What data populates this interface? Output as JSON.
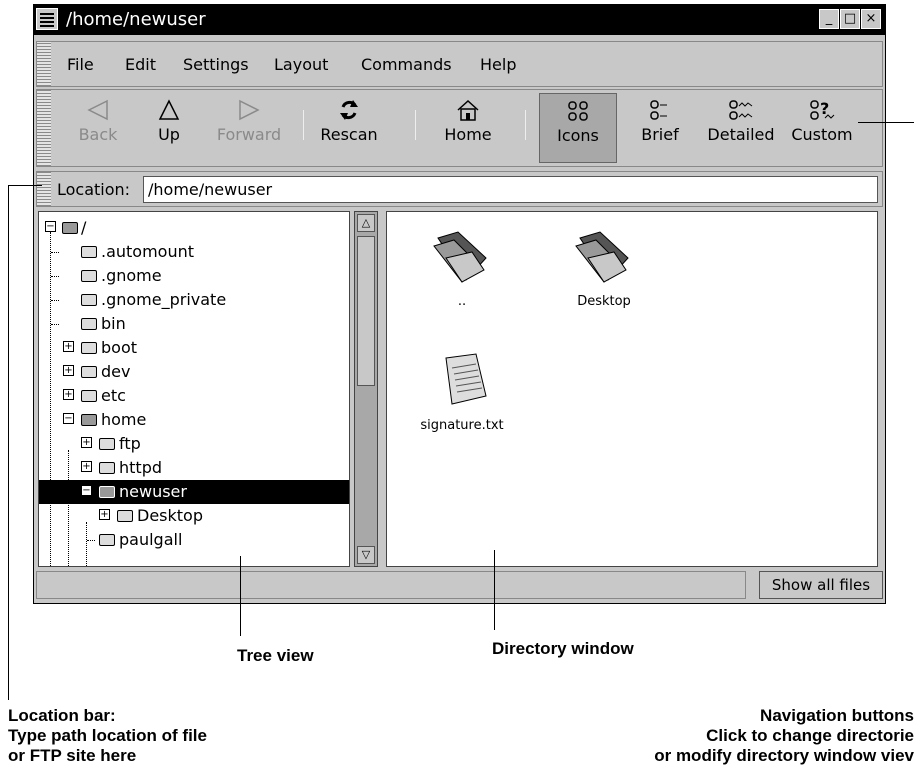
{
  "window": {
    "title": "/home/newuser",
    "controls": {
      "minimize": "_",
      "maximize": "□",
      "close": "×"
    }
  },
  "menubar": {
    "items": [
      {
        "label": "File"
      },
      {
        "label": "Edit"
      },
      {
        "label": "Settings"
      },
      {
        "label": "Layout"
      },
      {
        "label": "Commands"
      },
      {
        "label": "Help"
      }
    ]
  },
  "toolbar": {
    "back": {
      "label": "Back",
      "icon": "left-triangle-icon",
      "enabled": false
    },
    "up": {
      "label": "Up",
      "icon": "up-triangle-icon",
      "enabled": true
    },
    "forward": {
      "label": "Forward",
      "icon": "right-triangle-icon",
      "enabled": false
    },
    "rescan": {
      "label": "Rescan",
      "icon": "refresh-icon"
    },
    "home": {
      "label": "Home",
      "icon": "house-icon"
    },
    "icons": {
      "label": "Icons",
      "icon": "icons-view-icon",
      "pressed": true
    },
    "brief": {
      "label": "Brief",
      "icon": "brief-view-icon"
    },
    "detailed": {
      "label": "Detailed",
      "icon": "detailed-view-icon"
    },
    "custom": {
      "label": "Custom",
      "icon": "custom-view-icon"
    }
  },
  "location": {
    "label": "Location:",
    "value": "/home/newuser"
  },
  "tree": {
    "root": "/",
    "items": [
      {
        "label": ".automount"
      },
      {
        "label": ".gnome"
      },
      {
        "label": ".gnome_private"
      },
      {
        "label": "bin"
      },
      {
        "label": "boot",
        "expander": "+"
      },
      {
        "label": "dev",
        "expander": "+"
      },
      {
        "label": "etc",
        "expander": "+"
      },
      {
        "label": "home",
        "expander": "−"
      },
      {
        "label": "ftp",
        "expander": "+"
      },
      {
        "label": "httpd",
        "expander": "+"
      },
      {
        "label": "newuser",
        "expander": "−",
        "selected": true
      },
      {
        "label": "Desktop",
        "expander": "+"
      },
      {
        "label": "paulgall"
      }
    ],
    "root_expander": "−"
  },
  "directory": {
    "files": [
      {
        "label": "..",
        "icon": "folder-icon"
      },
      {
        "label": "Desktop",
        "icon": "folder-icon"
      },
      {
        "label": "signature.txt",
        "icon": "text-file-icon"
      }
    ]
  },
  "statusbar": {
    "show_all": "Show all files"
  },
  "annotations": {
    "tree_view": "Tree view",
    "directory_window": "Directory window",
    "location_bar": [
      "Location bar:",
      "Type path location of file",
      "or FTP site here"
    ],
    "navigation_buttons": [
      "Navigation buttons",
      "Click to change directorie",
      "or modify directory window viev"
    ]
  }
}
